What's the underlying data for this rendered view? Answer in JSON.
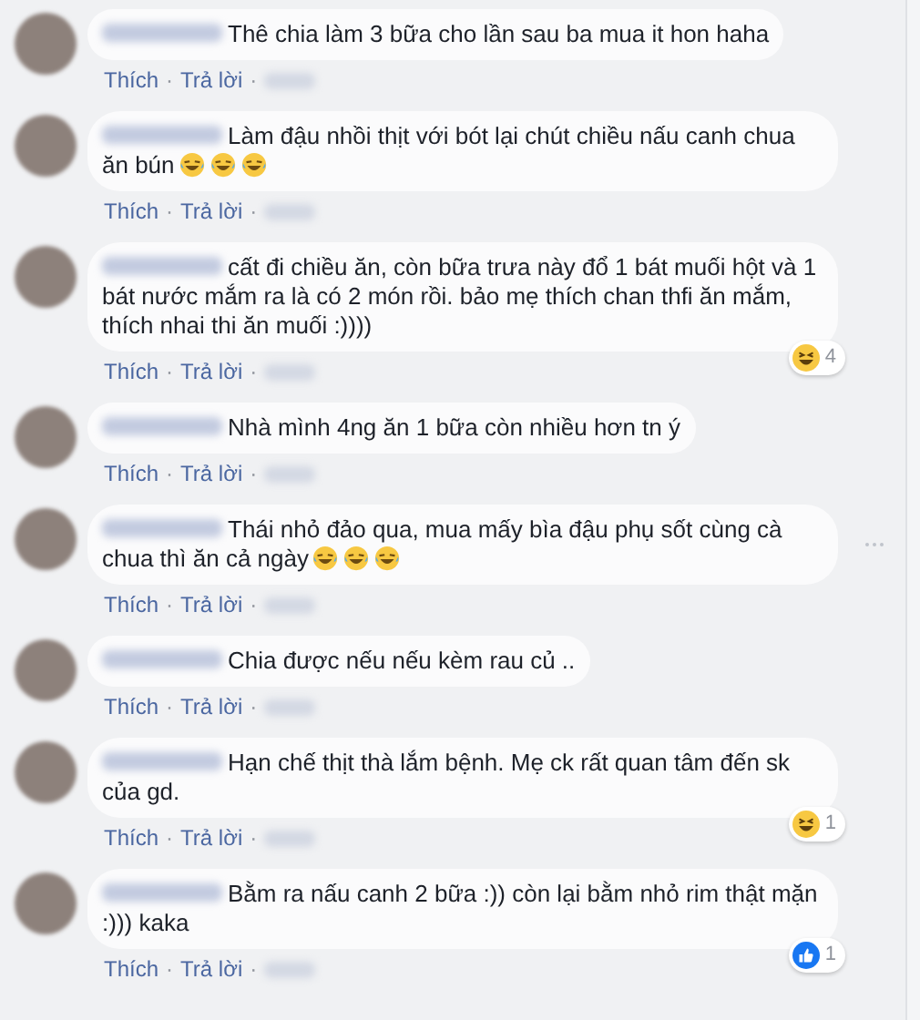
{
  "comments": [
    {
      "text": "Thê chia làm 3 bữa cho lần sau ba mua it hon haha",
      "actions": [
        "Thích",
        "·",
        "Trả lời",
        "·"
      ],
      "menu_shown": false
    },
    {
      "text": "Làm đậu nhồi thịt với bót lại chút chiều nấu canh chua ăn bún",
      "emojis": [
        {
          "kind": "tears-of-joy"
        },
        {
          "kind": "tears-of-joy"
        },
        {
          "kind": "tears-of-joy"
        }
      ],
      "actions": [
        "Thích",
        "·",
        "Trả lời",
        "·"
      ],
      "menu_shown": false
    },
    {
      "text": "cất đi chiều ăn, còn bữa trưa này đổ 1 bát muối hột và 1 bát nước mắm ra là có 2 món rồi. bảo mẹ thích chan thfi ăn mắm, thích nhai thi ăn muối :))))",
      "actions": [
        "Thích",
        "·",
        "Trả lời",
        "·"
      ],
      "reaction": {
        "kind": "haha",
        "count": "4"
      },
      "menu_shown": false
    },
    {
      "text": "Nhà mình 4ng ăn 1 bữa còn nhiều hơn tn ý",
      "actions": [
        "Thích",
        "·",
        "Trả lời",
        "·"
      ],
      "menu_shown": false
    },
    {
      "text": "Thái nhỏ đảo qua, mua mấy bìa đậu phụ sốt cùng cà chua thì ăn cả ngày",
      "emojis": [
        {
          "kind": "tears-of-joy"
        },
        {
          "kind": "tears-of-joy"
        },
        {
          "kind": "tears-of-joy"
        }
      ],
      "actions": [
        "Thích",
        "·",
        "Trả lời",
        "·"
      ],
      "menu_shown": true
    },
    {
      "text": "Chia được nếu nếu kèm rau củ ..",
      "actions": [
        "Thích",
        "·",
        "Trả lời",
        "·"
      ],
      "menu_shown": false
    },
    {
      "text": "Hạn chế thịt thà lắm bệnh. Mẹ ck rất quan tâm đến sk của gd.",
      "actions": [
        "Thích",
        "·",
        "Trả lời",
        "·"
      ],
      "reaction": {
        "kind": "haha",
        "count": "1"
      },
      "menu_shown": false
    },
    {
      "text": "Bằm ra nấu canh 2 bữa :)) còn lại bằm nhỏ rim thật mặn :))) kaka",
      "actions": [
        "Thích",
        "·",
        "Trả lời",
        "·"
      ],
      "reaction": {
        "kind": "like",
        "count": "1"
      },
      "menu_shown": false
    }
  ]
}
